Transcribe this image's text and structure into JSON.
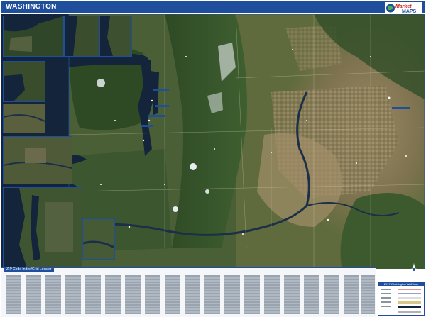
{
  "header": {
    "title": "WASHINGTON"
  },
  "logo": {
    "name_part1": "Market",
    "name_part2": "MAPS"
  },
  "colors": {
    "header_blue": "#1f4f9c",
    "water": "#14243a",
    "land_green": "#3f5a2c",
    "land_brown": "#8b7a5a",
    "snow": "#e8ecef"
  },
  "icons": {
    "compass": "compass-rose-icon"
  },
  "footer": {
    "zip_index_title": "ZIP Code Index/Grid Locator"
  },
  "legend": {
    "title": "2017 Washington Wall Map"
  }
}
